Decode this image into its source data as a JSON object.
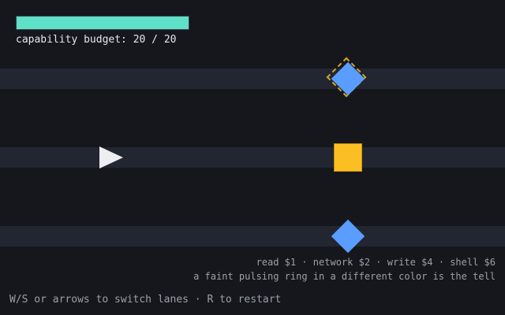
{
  "budget": {
    "label": "capability budget: 20 / 20",
    "current": 20,
    "max": 20,
    "fill_fraction": 1.0,
    "bar_color": "#5fe0c8"
  },
  "lanes": {
    "count": 3,
    "player_lane": 2
  },
  "entities": [
    {
      "kind": "diamond",
      "lane": 1,
      "color": "#5b9dff",
      "ring": true,
      "ring_color": "#d4a22a"
    },
    {
      "kind": "square",
      "lane": 2,
      "color": "#fbbf24",
      "ring": false
    },
    {
      "kind": "diamond",
      "lane": 3,
      "color": "#5b9dff",
      "ring": false
    }
  ],
  "legend": {
    "costs": "read $1 · network $2 · write $4 · shell $6",
    "tell": "a faint pulsing ring in a different color is the tell"
  },
  "controls": "W/S or arrows to switch lanes · R to restart"
}
